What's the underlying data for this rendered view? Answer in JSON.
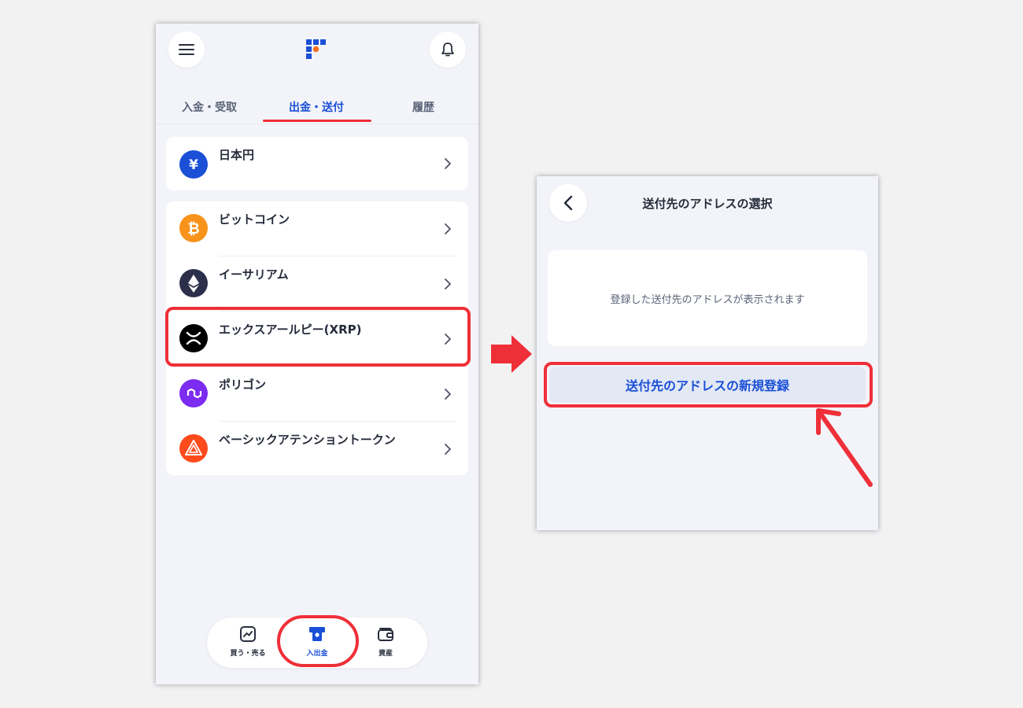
{
  "left_screen": {
    "tabs": [
      {
        "label": "入金・受取"
      },
      {
        "label": "出金・送付"
      },
      {
        "label": "履歴"
      }
    ],
    "fiat": [
      {
        "label": "日本円",
        "icon": "yen-icon",
        "color": "#1a4fd6"
      }
    ],
    "crypto": [
      {
        "label": "ビットコイン",
        "icon": "bitcoin-icon",
        "color": "#f7931a"
      },
      {
        "label": "イーサリアム",
        "icon": "ethereum-icon",
        "color": "#2b2f4a"
      },
      {
        "label": "エックスアールピー(XRP)",
        "icon": "xrp-icon",
        "color": "#000000"
      },
      {
        "label": "ポリゴン",
        "icon": "polygon-icon",
        "color": "#7b2cf0"
      },
      {
        "label": "ベーシックアテンショントークン",
        "icon": "bat-icon",
        "color": "#ff4a1c"
      }
    ],
    "bottom_nav": [
      {
        "label": "買う・売る",
        "icon": "chart-icon"
      },
      {
        "label": "入出金",
        "icon": "deposit-icon"
      },
      {
        "label": "資産",
        "icon": "wallet-icon"
      }
    ]
  },
  "right_screen": {
    "title": "送付先のアドレスの選択",
    "empty_message": "登録した送付先のアドレスが表示されます",
    "new_button_label": "送付先のアドレスの新規登録"
  },
  "colors": {
    "accent": "#1a4fd6",
    "highlight": "#ef2f38",
    "background": "#f3f4fa"
  }
}
